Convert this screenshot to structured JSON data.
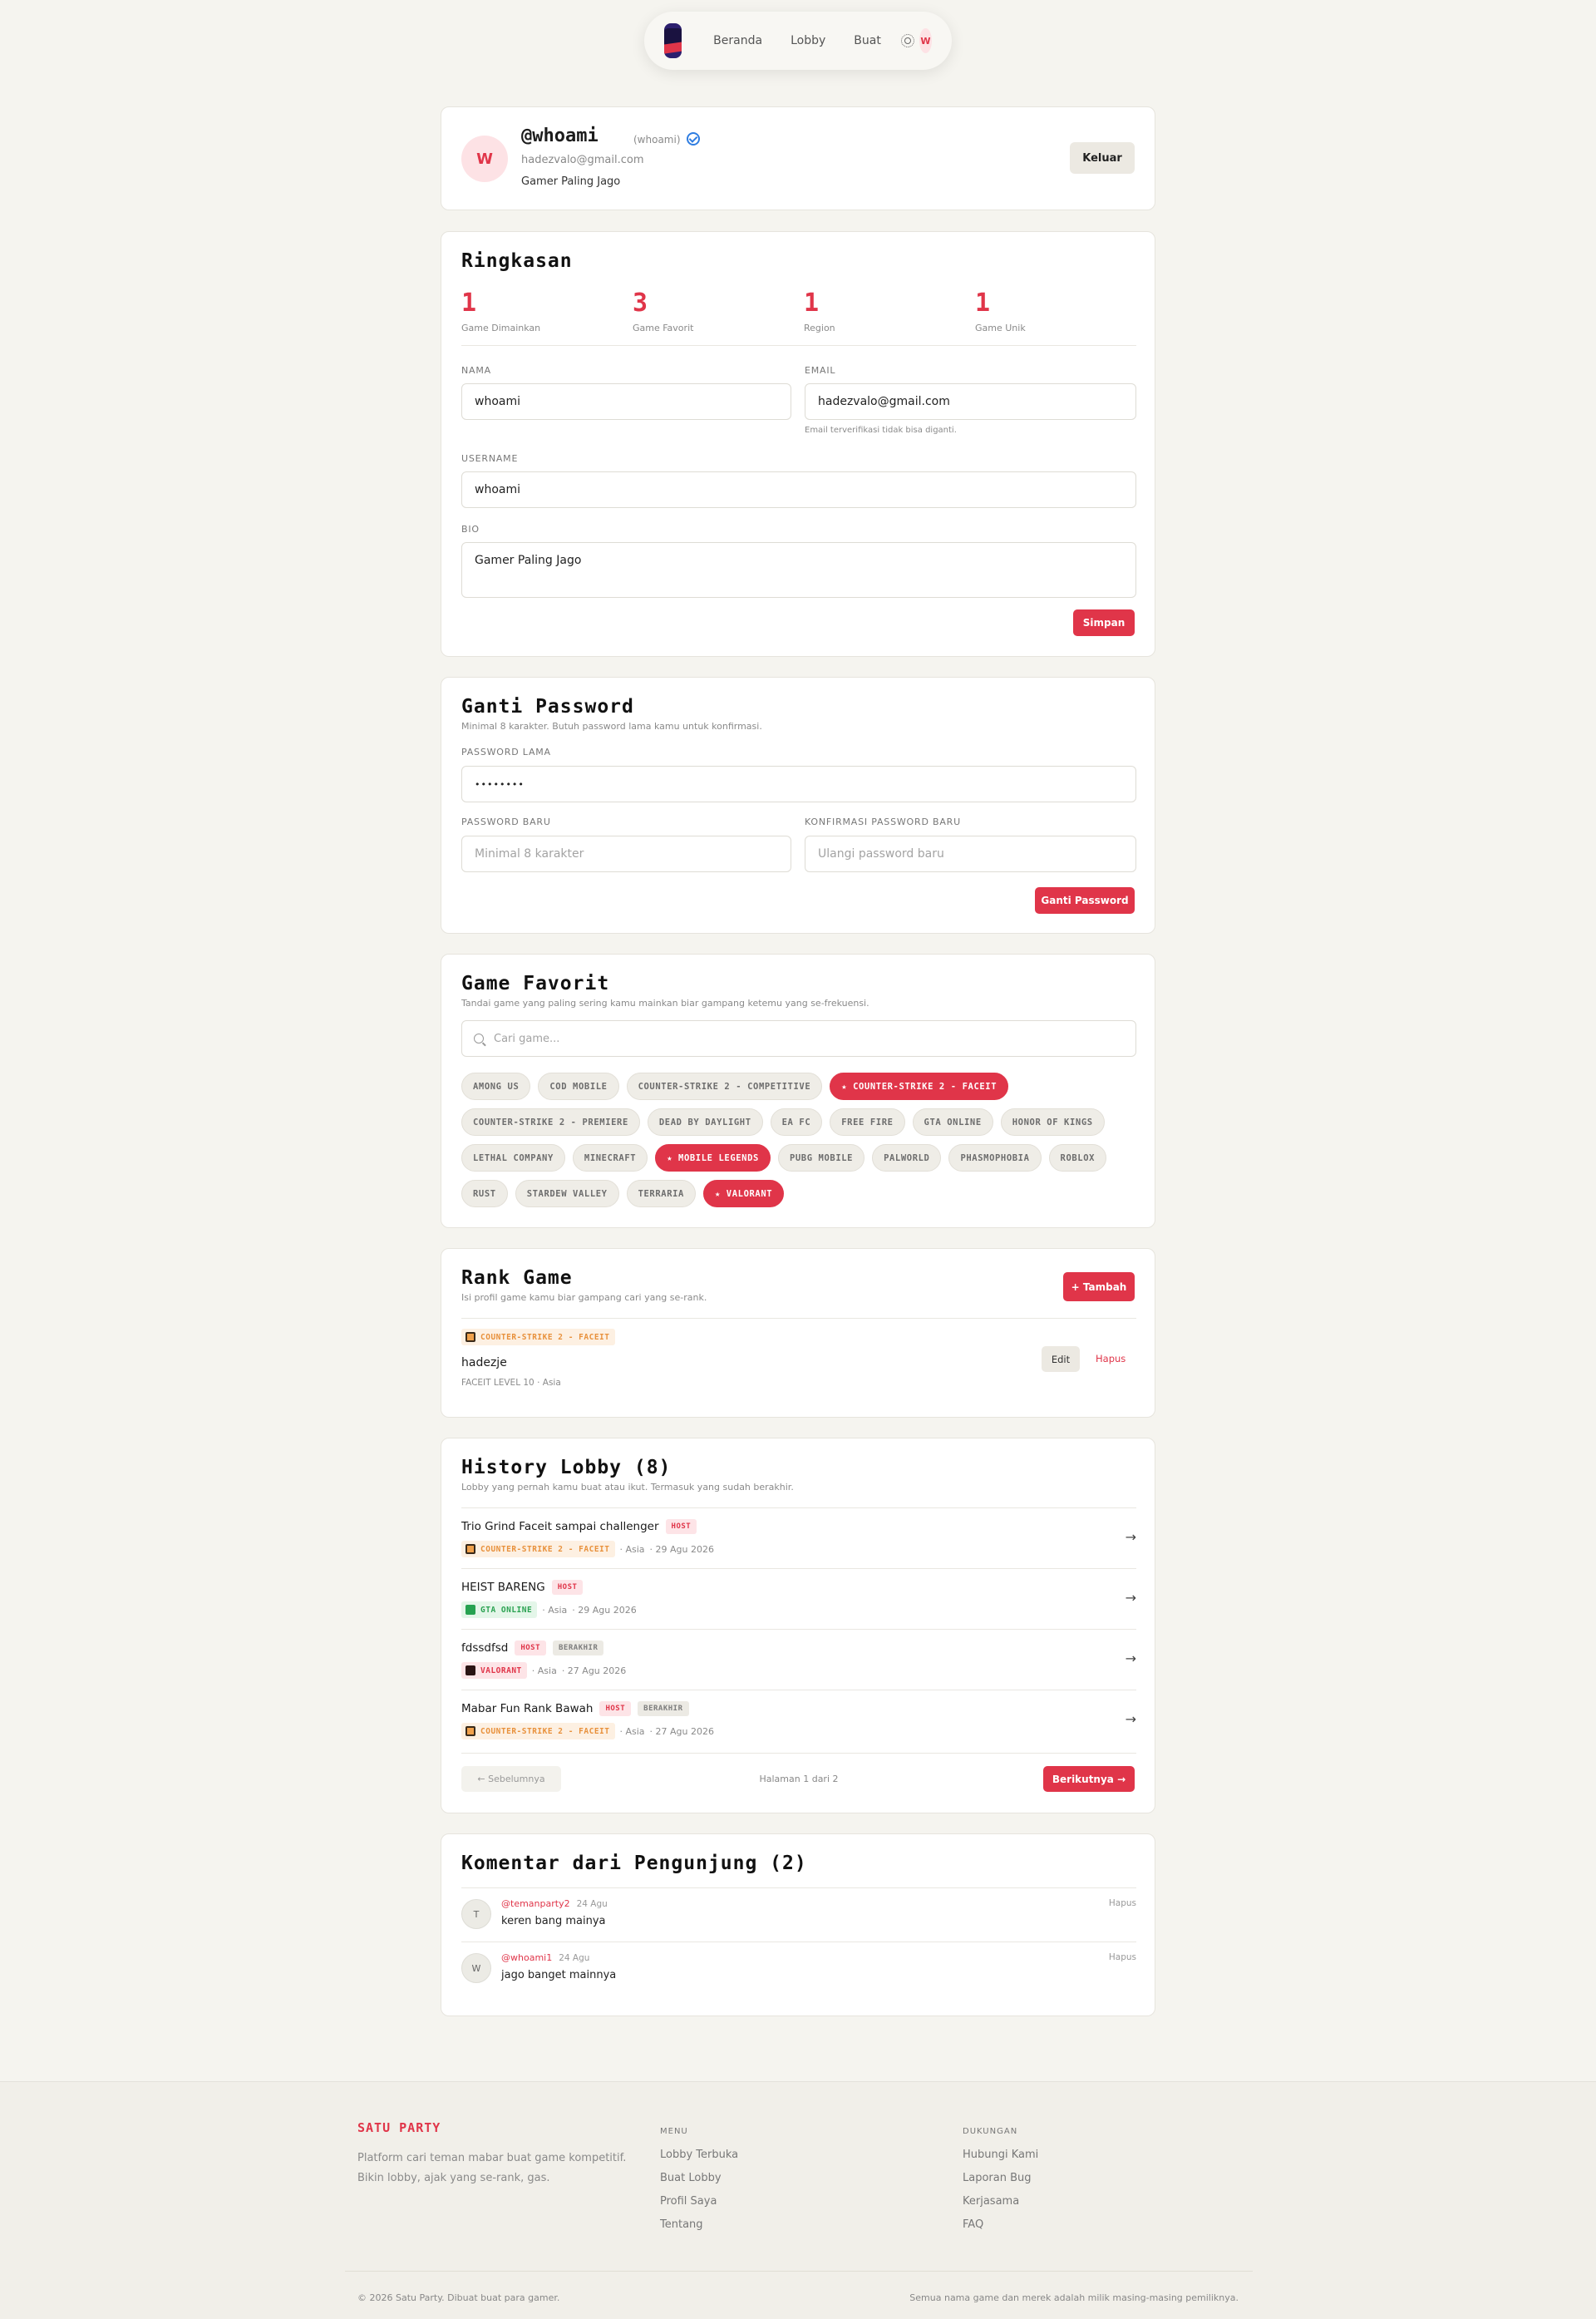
{
  "nav": {
    "links": [
      "Beranda",
      "Lobby",
      "Buat"
    ],
    "avatar_initial": "W"
  },
  "profile": {
    "avatar_initial": "W",
    "handle": "@whoami",
    "username_paren": "(whoami)",
    "email": "hadezvalo@gmail.com",
    "bio": "Gamer Paling Jago",
    "logout_label": "Keluar"
  },
  "summary": {
    "title": "Ringkasan",
    "stats": [
      {
        "value": "1",
        "label": "Game Dimainkan"
      },
      {
        "value": "3",
        "label": "Game Favorit"
      },
      {
        "value": "1",
        "label": "Region"
      },
      {
        "value": "1",
        "label": "Game Unik"
      }
    ],
    "form": {
      "name_label": "NAMA",
      "name_value": "whoami",
      "email_label": "EMAIL",
      "email_value": "hadezvalo@gmail.com",
      "email_hint": "Email terverifikasi tidak bisa diganti.",
      "username_label": "USERNAME",
      "username_value": "whoami",
      "bio_label": "BIO",
      "bio_value": "Gamer Paling Jago",
      "save_label": "Simpan"
    }
  },
  "password": {
    "title": "Ganti Password",
    "subtitle": "Minimal 8 karakter. Butuh password lama kamu untuk konfirmasi.",
    "old_label": "PASSWORD LAMA",
    "old_value": "••••••••",
    "new_label": "PASSWORD BARU",
    "new_placeholder": "Minimal 8 karakter",
    "confirm_label": "KONFIRMASI PASSWORD BARU",
    "confirm_placeholder": "Ulangi password baru",
    "submit_label": "Ganti Password"
  },
  "favorites": {
    "title": "Game Favorit",
    "subtitle": "Tandai game yang paling sering kamu mainkan biar gampang ketemu yang se-frekuensi.",
    "search_placeholder": "Cari game...",
    "games": [
      {
        "name": "AMONG US",
        "selected": false
      },
      {
        "name": "COD MOBILE",
        "selected": false
      },
      {
        "name": "COUNTER-STRIKE 2 - COMPETITIVE",
        "selected": false
      },
      {
        "name": "★ COUNTER-STRIKE 2 - FACEIT",
        "selected": true
      },
      {
        "name": "COUNTER-STRIKE 2 - PREMIERE",
        "selected": false
      },
      {
        "name": "DEAD BY DAYLIGHT",
        "selected": false
      },
      {
        "name": "EA FC",
        "selected": false
      },
      {
        "name": "FREE FIRE",
        "selected": false
      },
      {
        "name": "GTA ONLINE",
        "selected": false
      },
      {
        "name": "HONOR OF KINGS",
        "selected": false
      },
      {
        "name": "LETHAL COMPANY",
        "selected": false
      },
      {
        "name": "MINECRAFT",
        "selected": false
      },
      {
        "name": "★ MOBILE LEGENDS",
        "selected": true
      },
      {
        "name": "PUBG MOBILE",
        "selected": false
      },
      {
        "name": "PALWORLD",
        "selected": false
      },
      {
        "name": "PHASMOPHOBIA",
        "selected": false
      },
      {
        "name": "ROBLOX",
        "selected": false
      },
      {
        "name": "RUST",
        "selected": false
      },
      {
        "name": "STARDEW VALLEY",
        "selected": false
      },
      {
        "name": "TERRARIA",
        "selected": false
      },
      {
        "name": "★ VALORANT",
        "selected": true
      }
    ]
  },
  "rank": {
    "title": "Rank Game",
    "subtitle": "Isi profil game kamu biar gampang cari yang se-rank.",
    "add_label": "+ Tambah",
    "entry": {
      "game": "COUNTER-STRIKE 2 - FACEIT",
      "ign": "hadezje",
      "level": "FACEIT LEVEL 10",
      "region": "· Asia",
      "edit_label": "Edit",
      "delete_label": "Hapus"
    }
  },
  "history": {
    "title": "History Lobby (8)",
    "subtitle": "Lobby yang pernah kamu buat atau ikut. Termasuk yang sudah berakhir.",
    "lobbies": [
      {
        "title": "Trio Grind Faceit sampai challenger",
        "host": "HOST",
        "ended": "",
        "game": "COUNTER-STRIKE 2 - FACEIT",
        "region": "· Asia",
        "date": "· 29 Agu 2026"
      },
      {
        "title": "HEIST BARENG",
        "host": "HOST",
        "ended": "",
        "game": "GTA ONLINE",
        "region": "· Asia",
        "date": "· 29 Agu 2026"
      },
      {
        "title": "fdssdfsd",
        "host": "HOST",
        "ended": "BERAKHIR",
        "game": "VALORANT",
        "region": "· Asia",
        "date": "· 27 Agu 2026"
      },
      {
        "title": "Mabar Fun Rank Bawah",
        "host": "HOST",
        "ended": "BERAKHIR",
        "game": "COUNTER-STRIKE 2 - FACEIT",
        "region": "· Asia",
        "date": "· 27 Agu 2026"
      }
    ],
    "prev_label": "← Sebelumnya",
    "page_label": "Halaman 1 dari 2",
    "next_label": "Berikutnya →"
  },
  "comments": {
    "title": "Komentar dari Pengunjung (2)",
    "items": [
      {
        "initial": "T",
        "user": "@temanparty2",
        "date": "24 Agu",
        "text": "keren bang mainya",
        "delete_label": "Hapus"
      },
      {
        "initial": "W",
        "user": "@whoami1",
        "date": "24 Agu",
        "text": "jago banget mainnya",
        "delete_label": "Hapus"
      }
    ]
  },
  "footer": {
    "brand": "SATU PARTY",
    "desc": "Platform cari teman mabar buat game kompetitif. Bikin lobby, ajak yang se-rank, gas.",
    "menu_head": "MENU",
    "menu": [
      "Lobby Terbuka",
      "Buat Lobby",
      "Profil Saya",
      "Tentang"
    ],
    "support_head": "DUKUNGAN",
    "support": [
      "Hubungi Kami",
      "Laporan Bug",
      "Kerjasama",
      "FAQ"
    ],
    "copyright": "© 2026 Satu Party. Dibuat buat para gamer.",
    "legal": "Semua nama game dan merek adalah milik masing-masing pemiliknya."
  }
}
